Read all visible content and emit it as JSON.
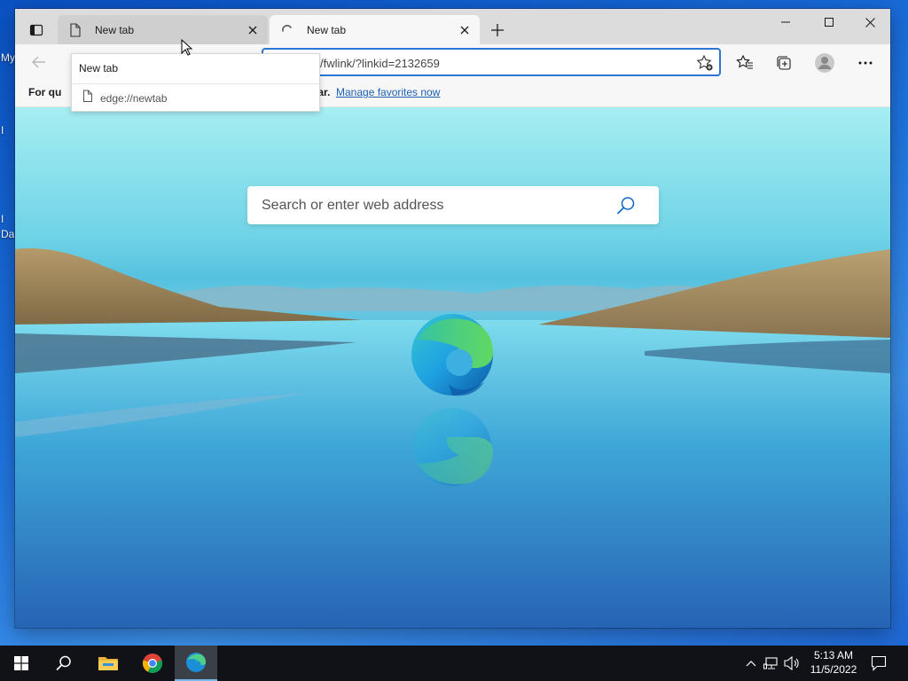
{
  "desktop": {
    "icon_fragments": [
      "My",
      "I",
      "I",
      "Da"
    ]
  },
  "browser": {
    "tabs": [
      {
        "label": "New tab",
        "state": "inactive",
        "icon": "page-icon"
      },
      {
        "label": "New tab",
        "state": "active-loading",
        "icon": "loading-spinner-icon"
      }
    ],
    "address_bar": {
      "value": "om/fwlink/?linkid=2132659"
    },
    "favorites_bar": {
      "text_left": "For qu",
      "text_mid": "s bar.",
      "link": "Manage favorites now"
    },
    "tab_hover_card": {
      "title": "New tab",
      "url": "edge://newtab"
    },
    "new_tab_page": {
      "search_placeholder": "Search or enter web address"
    }
  },
  "taskbar": {
    "pinned": [
      "windows-start-icon",
      "search-icon",
      "file-explorer-icon",
      "chrome-icon",
      "edge-icon"
    ],
    "active_app": "edge-icon",
    "clock": {
      "time": "5:13 AM",
      "date": "11/5/2022"
    }
  },
  "colors": {
    "accent": "#2a76d2",
    "link": "#1a5fb4",
    "taskbar": "#101218"
  }
}
